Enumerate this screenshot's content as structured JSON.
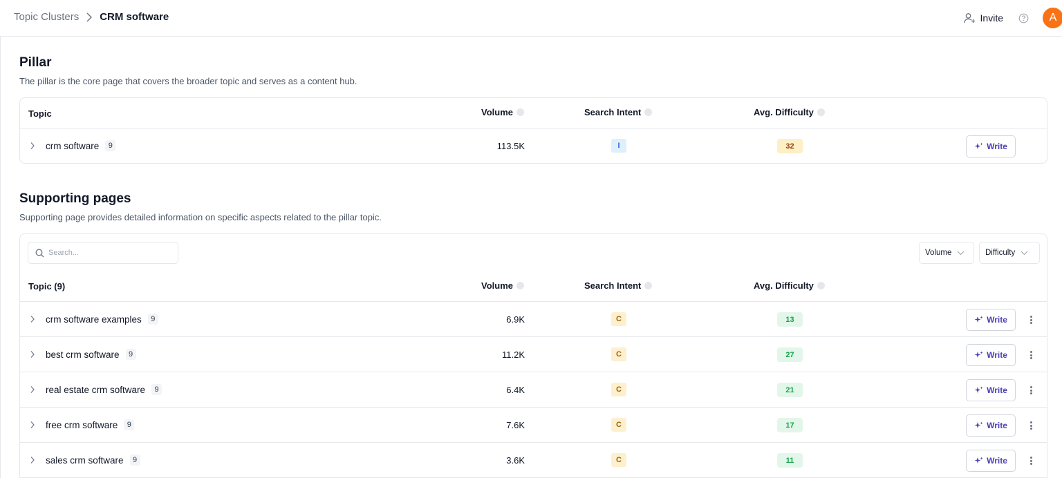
{
  "breadcrumb": {
    "parent": "Topic Clusters",
    "current": "CRM software"
  },
  "top_actions": {
    "invite_label": "Invite",
    "avatar_letter": "A"
  },
  "colors": {
    "avatar": "#f97316",
    "write_accent": "#4c3fb5",
    "intent_informational": "#2563eb",
    "intent_commercial": "#a16207",
    "difficulty_easy": "#16a34a",
    "difficulty_medium": "#92400e"
  },
  "icons": {
    "invite": "add-user-icon",
    "help": "help-circle-icon",
    "expand": "chevron-right-icon",
    "write": "sparkle-icon",
    "more": "kebab-menu-icon",
    "search": "search-icon",
    "dropdown": "chevron-down-icon"
  },
  "pillar": {
    "title": "Pillar",
    "description": "The pillar is the core page that covers the broader topic and serves as a content hub.",
    "columns": {
      "topic": "Topic",
      "volume": "Volume",
      "intent": "Search Intent",
      "difficulty": "Avg. Difficulty"
    },
    "row": {
      "topic": "crm software",
      "count": "9",
      "volume": "113.5K",
      "intent": "I",
      "difficulty": "32",
      "write_label": "Write"
    }
  },
  "supporting": {
    "title": "Supporting pages",
    "description": "Supporting page provides detailed information on specific aspects related to the pillar topic.",
    "search_placeholder": "Search...",
    "filters": {
      "volume": "Volume",
      "difficulty": "Difficulty"
    },
    "columns": {
      "topic": "Topic (9)",
      "volume": "Volume",
      "intent": "Search Intent",
      "difficulty": "Avg. Difficulty"
    },
    "write_label": "Write",
    "rows": [
      {
        "topic": "crm software examples",
        "count": "9",
        "volume": "6.9K",
        "intent": "C",
        "difficulty": "13"
      },
      {
        "topic": "best crm software",
        "count": "9",
        "volume": "11.2K",
        "intent": "C",
        "difficulty": "27"
      },
      {
        "topic": "real estate crm software",
        "count": "9",
        "volume": "6.4K",
        "intent": "C",
        "difficulty": "21"
      },
      {
        "topic": "free crm software",
        "count": "9",
        "volume": "7.6K",
        "intent": "C",
        "difficulty": "17"
      },
      {
        "topic": "sales crm software",
        "count": "9",
        "volume": "3.6K",
        "intent": "C",
        "difficulty": "11"
      }
    ]
  }
}
